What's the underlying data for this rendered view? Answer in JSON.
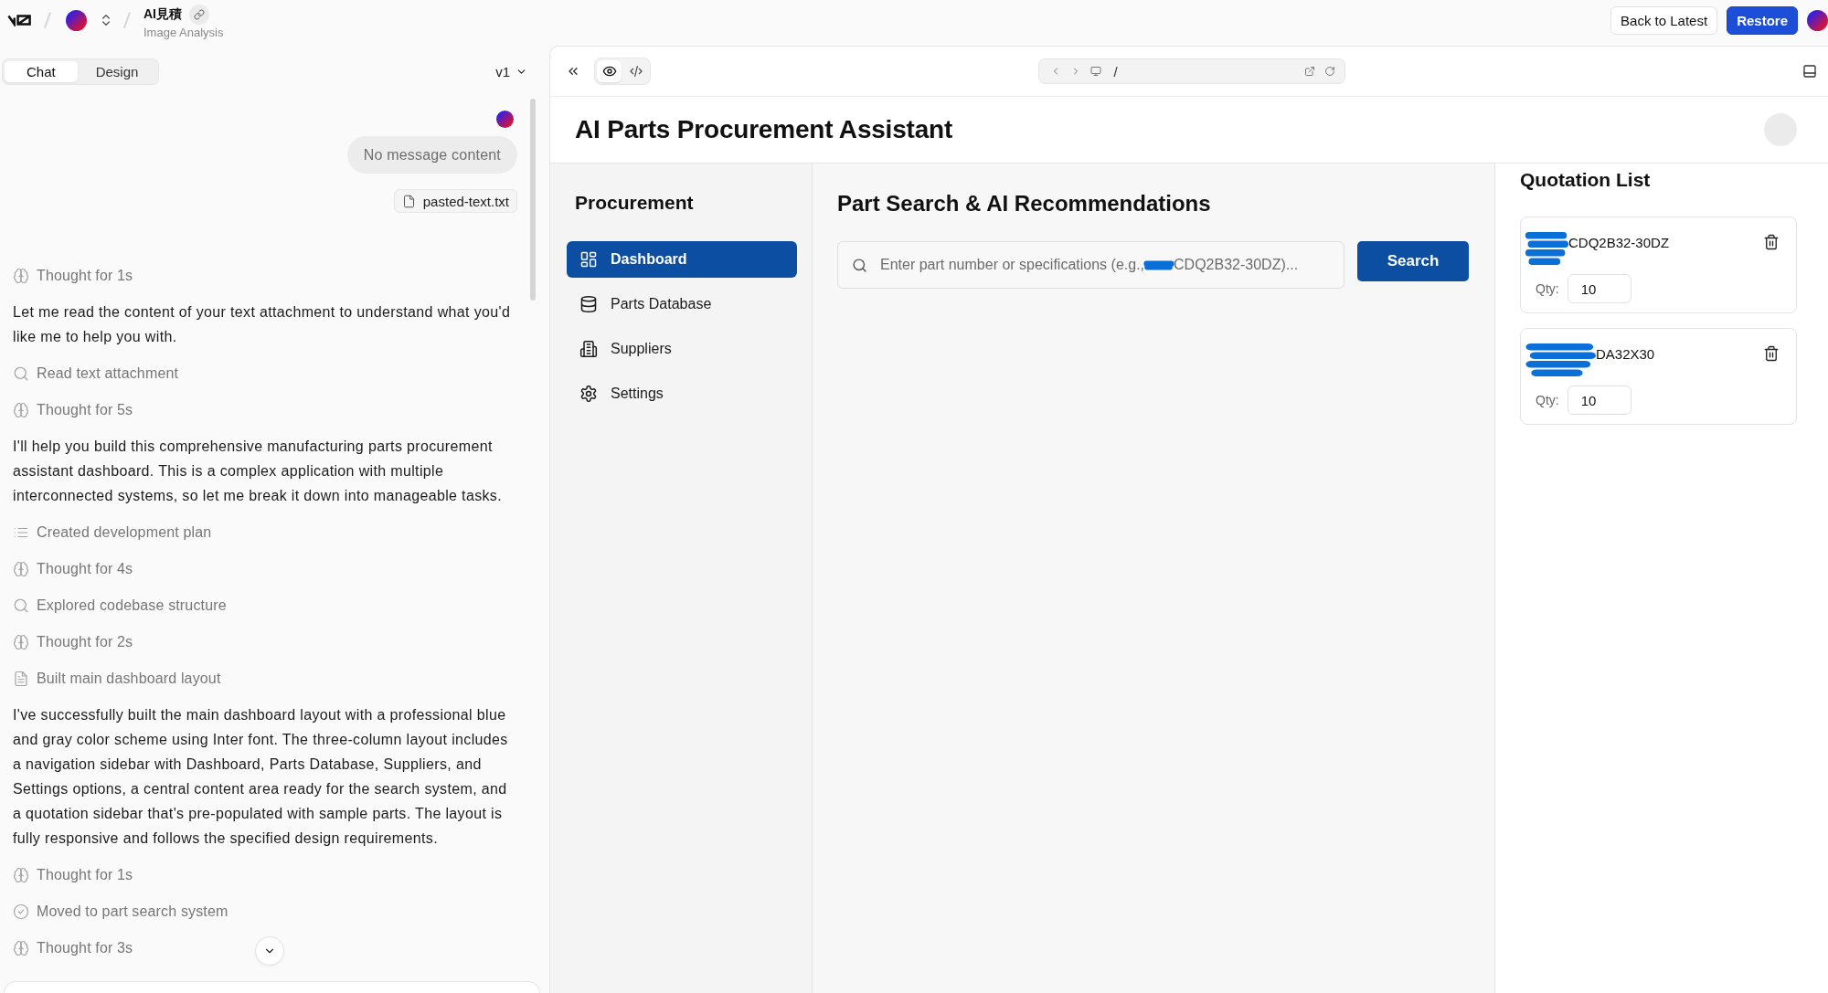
{
  "header": {
    "project": "AI見積",
    "subtitle": "Image Analysis",
    "buttons": [
      {
        "kind": "secondary",
        "label": "Back to Latest"
      },
      {
        "kind": "primary",
        "label": "Restore"
      }
    ]
  },
  "chat_panel": {
    "tabs": [
      {
        "label": "Chat",
        "selected": true
      },
      {
        "label": "Design",
        "selected": false
      }
    ],
    "version": "v1",
    "user_message": {
      "text": "No message content",
      "attachment": "pasted-text.txt"
    },
    "items": [
      {
        "kind": "thought",
        "text": "Thought for 1s"
      },
      {
        "kind": "message",
        "text": "Let me read the content of your text attachment to understand what you'd like me to help you with."
      },
      {
        "kind": "search",
        "text": "Read text attachment"
      },
      {
        "kind": "thought",
        "text": "Thought for 5s"
      },
      {
        "kind": "message",
        "text": "I'll help you build this comprehensive manufacturing parts procurement assistant dashboard. This is a complex application with multiple interconnected systems, so let me break it down into manageable tasks."
      },
      {
        "kind": "plan",
        "text": "Created development plan"
      },
      {
        "kind": "thought",
        "text": "Thought for 4s"
      },
      {
        "kind": "search",
        "text": "Explored codebase structure"
      },
      {
        "kind": "thought",
        "text": "Thought for 2s"
      },
      {
        "kind": "file",
        "text": "Built main dashboard layout"
      },
      {
        "kind": "message",
        "text": "I've successfully built the main dashboard layout with a professional blue and gray color scheme using Inter font. The three-column layout includes a navigation sidebar with Dashboard, Parts Database, Suppliers, and Settings options, a central content area ready for the search system, and a quotation sidebar that's pre-populated with sample parts. The layout is fully responsive and follows the specified design requirements."
      },
      {
        "kind": "thought",
        "text": "Thought for 1s"
      },
      {
        "kind": "done",
        "text": "Moved to part search system"
      },
      {
        "kind": "thought",
        "text": "Thought for 3s"
      }
    ]
  },
  "preview_toolbar": {
    "view_modes": [
      {
        "kind": "preview",
        "selected": true
      },
      {
        "kind": "code",
        "selected": false
      }
    ],
    "url": "/"
  },
  "app": {
    "title": "AI Parts Procurement Assistant",
    "sidebar": {
      "title": "Procurement",
      "items": [
        {
          "kind": "dashboard",
          "label": "Dashboard",
          "selected": true
        },
        {
          "kind": "database",
          "label": "Parts Database",
          "selected": false
        },
        {
          "kind": "suppliers",
          "label": "Suppliers",
          "selected": false
        },
        {
          "kind": "settings",
          "label": "Settings",
          "selected": false
        }
      ]
    },
    "search": {
      "title": "Part Search & AI Recommendations",
      "placeholder": [
        "Enter part number or specifications (e.g.,",
        "CDQ2B32-30DZ)..."
      ],
      "button": "Search"
    },
    "quotation": {
      "title": "Quotation List",
      "items": [
        {
          "part": "CDQ2B32-30DZ",
          "qty_label": "Qty:",
          "qty": "10"
        },
        {
          "part": "DA32X30",
          "qty_label": "Qty:",
          "qty": "10"
        }
      ]
    }
  }
}
